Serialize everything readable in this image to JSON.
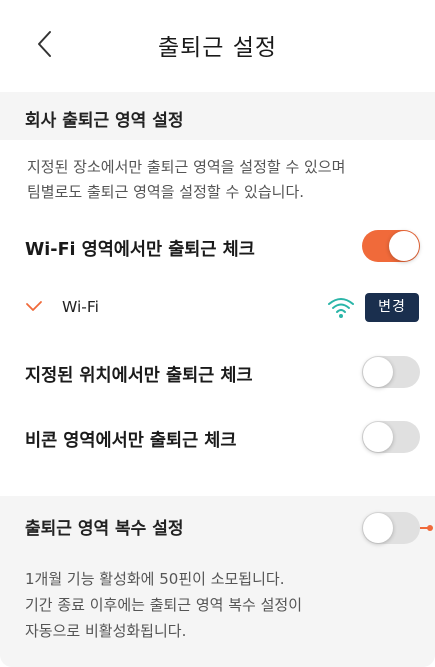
{
  "header": {
    "title": "출퇴근 설정"
  },
  "section1": {
    "title": "회사 출퇴근 영역 설정",
    "description_line1": "지정된 장소에서만 출퇴근 영역을 설정할 수 있으며",
    "description_line2": "팀별로도 출퇴근 영역을 설정할 수 있습니다."
  },
  "rows": {
    "wifi": {
      "label": "Wi-Fi 영역에서만 출퇴근 체크",
      "enabled": true
    },
    "location": {
      "label": "지정된 위치에서만 출퇴근 체크",
      "enabled": false
    },
    "beacon": {
      "label": "비콘 영역에서만 출퇴근 체크",
      "enabled": false
    }
  },
  "wifi_item": {
    "name": "Wi-Fi",
    "change_label": "변경",
    "icon": "wifi-icon"
  },
  "section2": {
    "title": "출퇴근 영역 복수 설정",
    "enabled": false,
    "description_line1": "1개월 기능 활성화에 50핀이 소모됩니다.",
    "description_line2": "기간 종료 이후에는 출퇴근 영역 복수 설정이",
    "description_line3": "자동으로 비활성화됩니다."
  },
  "colors": {
    "accent": "#f06a3a",
    "button_navy": "#1a2f4e",
    "wifi_teal": "#2bb5a8",
    "section_bg": "#f5f5f5"
  }
}
